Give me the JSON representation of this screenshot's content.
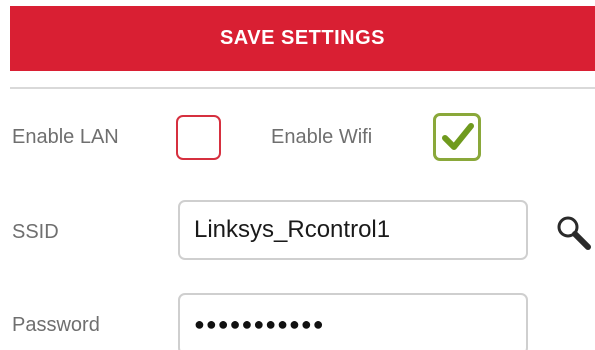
{
  "header": {
    "save_label": "SAVE SETTINGS",
    "bar_color": "#d91f33"
  },
  "toggles": {
    "lan": {
      "label": "Enable LAN",
      "checked": false,
      "color": "#d6303f"
    },
    "wifi": {
      "label": "Enable Wifi",
      "checked": true,
      "color": "#8aa83a"
    }
  },
  "fields": {
    "ssid": {
      "label": "SSID",
      "value": "Linksys_Rcontrol1"
    },
    "password": {
      "label": "Password",
      "value": "●●●●●●●●●●●"
    }
  },
  "icons": {
    "search": "magnifier-icon",
    "check": "checkmark-icon"
  }
}
